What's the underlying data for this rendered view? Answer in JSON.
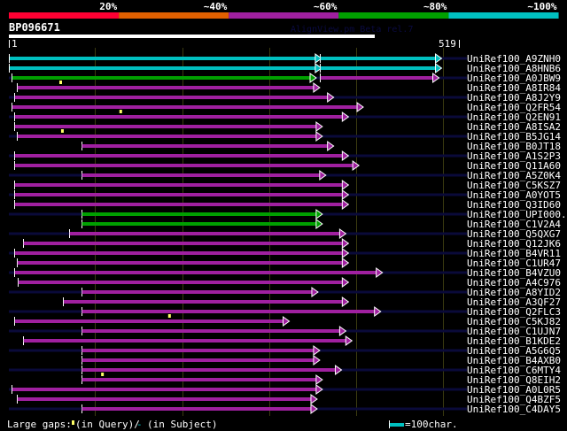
{
  "identity_scale": {
    "labels": [
      "20%",
      "~40%",
      "~60%",
      "~80%",
      "~100%"
    ],
    "colors": [
      "#ff0033",
      "#e06000",
      "#a020a0",
      "#00a000",
      "#00c0c0"
    ]
  },
  "query": {
    "name": "BP096671",
    "length": 519,
    "start_label": "1",
    "end_label": "519"
  },
  "watermark": "AlignView.pm Beta rel.7",
  "rows": [
    {
      "name": "UniRef100_A9ZNH0",
      "segments": [
        [
          1,
          353,
          "#00c0c0"
        ],
        [
          358,
          491,
          "#00c0c0"
        ]
      ],
      "qgaps": []
    },
    {
      "name": "UniRef100_A8HNB6",
      "segments": [
        [
          1,
          353,
          "#00c0c0"
        ],
        [
          358,
          491,
          "#00c0c0"
        ]
      ],
      "qgaps": []
    },
    {
      "name": "UniRef100_A0JBW9",
      "segments": [
        [
          4,
          347,
          "#00a000"
        ],
        [
          358,
          488,
          "#a020a0"
        ]
      ],
      "qgaps": [
        59
      ]
    },
    {
      "name": "UniRef100_A8IR84",
      "segments": [
        [
          10,
          351,
          "#a020a0"
        ]
      ],
      "qgaps": []
    },
    {
      "name": "UniRef100_A8J2Y9",
      "segments": [
        [
          7,
          367,
          "#a020a0"
        ]
      ],
      "qgaps": []
    },
    {
      "name": "UniRef100_Q2FR54",
      "segments": [
        [
          4,
          401,
          "#a020a0"
        ]
      ],
      "qgaps": [
        128
      ]
    },
    {
      "name": "UniRef100_Q2EN91",
      "segments": [
        [
          7,
          384,
          "#a020a0"
        ]
      ],
      "qgaps": []
    },
    {
      "name": "UniRef100_A8ISA2",
      "segments": [
        [
          7,
          354,
          "#a020a0"
        ]
      ],
      "qgaps": [
        61
      ]
    },
    {
      "name": "UniRef100_B5JG14",
      "segments": [
        [
          10,
          354,
          "#a020a0"
        ]
      ],
      "qgaps": []
    },
    {
      "name": "UniRef100_B0JT18",
      "segments": [
        [
          84,
          367,
          "#a020a0"
        ]
      ],
      "qgaps": []
    },
    {
      "name": "UniRef100_A1S2P3",
      "segments": [
        [
          7,
          384,
          "#a020a0"
        ]
      ],
      "qgaps": []
    },
    {
      "name": "UniRef100_Q11A60",
      "segments": [
        [
          7,
          396,
          "#a020a0"
        ]
      ],
      "qgaps": []
    },
    {
      "name": "UniRef100_A5Z0K4",
      "segments": [
        [
          84,
          358,
          "#a020a0"
        ]
      ],
      "qgaps": []
    },
    {
      "name": "UniRef100_C5KSZ7",
      "segments": [
        [
          7,
          384,
          "#a020a0"
        ]
      ],
      "qgaps": []
    },
    {
      "name": "UniRef100_A0YOT5",
      "segments": [
        [
          7,
          384,
          "#a020a0"
        ]
      ],
      "qgaps": []
    },
    {
      "name": "UniRef100_Q3ID60",
      "segments": [
        [
          7,
          384,
          "#a020a0"
        ]
      ],
      "qgaps": []
    },
    {
      "name": "UniRef100_UPI000..",
      "segments": [
        [
          84,
          354,
          "#00a000"
        ]
      ],
      "qgaps": []
    },
    {
      "name": "UniRef100_C1V2A4",
      "segments": [
        [
          84,
          354,
          "#00a000"
        ]
      ],
      "qgaps": []
    },
    {
      "name": "UniRef100_Q5QXG7",
      "segments": [
        [
          70,
          381,
          "#a020a0"
        ]
      ],
      "qgaps": []
    },
    {
      "name": "UniRef100_Q12JK6",
      "segments": [
        [
          17,
          384,
          "#a020a0"
        ]
      ],
      "qgaps": []
    },
    {
      "name": "UniRef100_B4VR11",
      "segments": [
        [
          7,
          384,
          "#a020a0"
        ]
      ],
      "qgaps": []
    },
    {
      "name": "UniRef100_C1UR47",
      "segments": [
        [
          10,
          384,
          "#a020a0"
        ]
      ],
      "qgaps": []
    },
    {
      "name": "UniRef100_B4VZU0",
      "segments": [
        [
          7,
          423,
          "#a020a0"
        ]
      ],
      "qgaps": []
    },
    {
      "name": "UniRef100_A4C976",
      "segments": [
        [
          11,
          384,
          "#a020a0"
        ]
      ],
      "qgaps": []
    },
    {
      "name": "UniRef100_A8YID2",
      "segments": [
        [
          84,
          349,
          "#a020a0"
        ]
      ],
      "qgaps": []
    },
    {
      "name": "UniRef100_A3QF27",
      "segments": [
        [
          63,
          384,
          "#a020a0"
        ]
      ],
      "qgaps": []
    },
    {
      "name": "UniRef100_Q2FLC3",
      "segments": [
        [
          84,
          421,
          "#a020a0"
        ]
      ],
      "qgaps": [
        184
      ]
    },
    {
      "name": "UniRef100_C5KJ82",
      "segments": [
        [
          7,
          316,
          "#a020a0"
        ]
      ],
      "qgaps": []
    },
    {
      "name": "UniRef100_C1UJN7",
      "segments": [
        [
          84,
          381,
          "#a020a0"
        ]
      ],
      "qgaps": []
    },
    {
      "name": "UniRef100_B1KDE2",
      "segments": [
        [
          17,
          388,
          "#a020a0"
        ]
      ],
      "qgaps": []
    },
    {
      "name": "UniRef100_A5G6Q5",
      "segments": [
        [
          84,
          351,
          "#a020a0"
        ]
      ],
      "qgaps": []
    },
    {
      "name": "UniRef100_B4AXB0",
      "segments": [
        [
          84,
          351,
          "#a020a0"
        ]
      ],
      "qgaps": []
    },
    {
      "name": "UniRef100_C6MTY4",
      "segments": [
        [
          84,
          376,
          "#a020a0"
        ]
      ],
      "qgaps": [
        107
      ]
    },
    {
      "name": "UniRef100_Q8EIH2",
      "segments": [
        [
          84,
          354,
          "#a020a0"
        ]
      ],
      "qgaps": []
    },
    {
      "name": "UniRef100_A0L0R5",
      "segments": [
        [
          4,
          354,
          "#a020a0"
        ]
      ],
      "qgaps": []
    },
    {
      "name": "UniRef100_Q4BZF5",
      "segments": [
        [
          10,
          348,
          "#a020a0"
        ]
      ],
      "qgaps": []
    },
    {
      "name": "UniRef100_C4DAY5",
      "segments": [
        [
          84,
          348,
          "#a020a0"
        ]
      ],
      "qgaps": []
    }
  ],
  "legend": {
    "large_gaps": "Large gaps:",
    "in_query": "(in Query)/",
    "dash": "-",
    "in_subject": "(in Subject)",
    "scale_label": "=100char.",
    "scale_color": "#00c0c0"
  }
}
